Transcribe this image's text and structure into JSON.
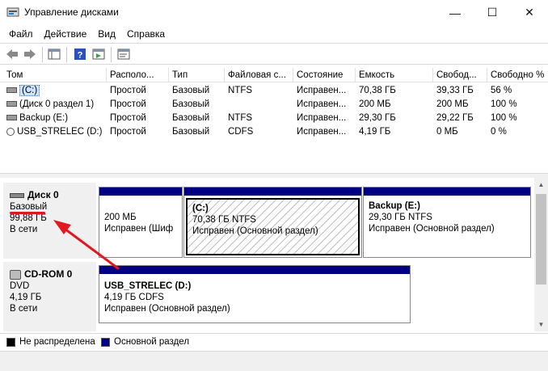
{
  "window": {
    "title": "Управление дисками",
    "controls": {
      "minimize": "—",
      "maximize": "☐",
      "close": "✕"
    }
  },
  "menu": [
    "Файл",
    "Действие",
    "Вид",
    "Справка"
  ],
  "table": {
    "columns": [
      "Том",
      "Располо...",
      "Тип",
      "Файловая с...",
      "Состояние",
      "Емкость",
      "Свобод...",
      "Свободно %"
    ],
    "rows": [
      [
        "(C:)",
        "Простой",
        "Базовый",
        "NTFS",
        "Исправен...",
        "70,38 ГБ",
        "39,33 ГБ",
        "56 %"
      ],
      [
        "(Диск 0 раздел 1)",
        "Простой",
        "Базовый",
        "",
        "Исправен...",
        "200 МБ",
        "200 МБ",
        "100 %"
      ],
      [
        "Backup (E:)",
        "Простой",
        "Базовый",
        "NTFS",
        "Исправен...",
        "29,30 ГБ",
        "29,22 ГБ",
        "100 %"
      ],
      [
        "USB_STRELEC (D:)",
        "Простой",
        "Базовый",
        "CDFS",
        "Исправен...",
        "4,19 ГБ",
        "0 МБ",
        "0 %"
      ]
    ]
  },
  "disks": [
    {
      "name": "Диск 0",
      "type": "Базовый",
      "size": "99,88 ГБ",
      "status": "В сети",
      "partitions": [
        {
          "name": "",
          "size": "200 МБ",
          "status": "Исправен (Шиф"
        },
        {
          "name": "(C:)",
          "size": "70,38 ГБ NTFS",
          "status": "Исправен (Основной раздел)"
        },
        {
          "name": "Backup  (E:)",
          "size": "29,30 ГБ NTFS",
          "status": "Исправен (Основной раздел)"
        }
      ]
    },
    {
      "name": "CD-ROM 0",
      "type": "DVD",
      "size": "4,19 ГБ",
      "status": "В сети",
      "partitions": [
        {
          "name": "USB_STRELEC  (D:)",
          "size": "4,19 ГБ CDFS",
          "status": "Исправен (Основной раздел)"
        }
      ]
    }
  ],
  "legend": [
    {
      "label": "Не распределена",
      "color": "#000000"
    },
    {
      "label": "Основной раздел",
      "color": "#000080"
    }
  ],
  "colors": {
    "partition_bar": "#000080",
    "annotation": "#e4161f"
  }
}
